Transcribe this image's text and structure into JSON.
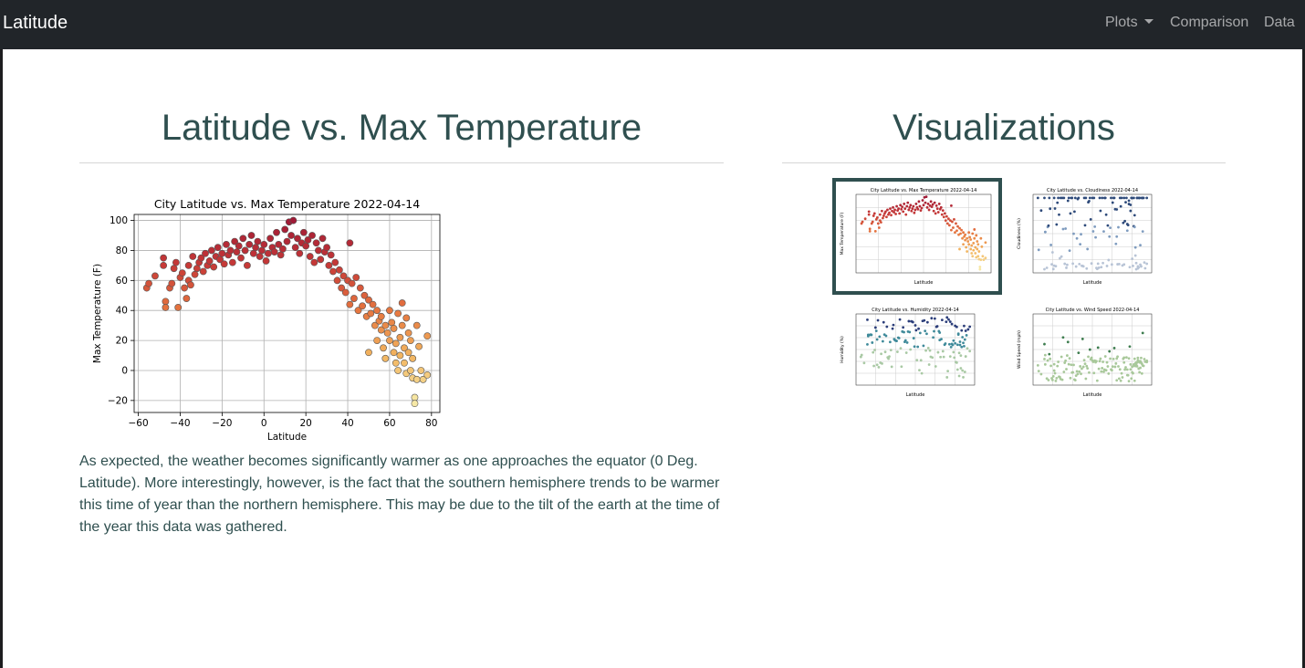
{
  "nav": {
    "brand": "Latitude",
    "items": [
      {
        "label": "Plots",
        "dropdown": true
      },
      {
        "label": "Comparison",
        "dropdown": false
      },
      {
        "label": "Data",
        "dropdown": false
      }
    ]
  },
  "main": {
    "title": "Latitude vs. Max Temperature",
    "description": "As expected, the weather becomes significantly warmer as one approaches the equator (0 Deg. Latitude). More interestingly, however, is the fact that the southern hemisphere trends to be warmer this time of year than the northern hemisphere. This may be due to the tilt of the earth at the time of the year this data was gathered."
  },
  "sidebar": {
    "title": "Visualizations",
    "thumbnails": [
      {
        "title": "City Latitude vs. Max Temperature 2022-04-14",
        "ylabel": "Max Temperature (F)",
        "active": true
      },
      {
        "title": "City Latitude vs. Cloudiness 2022-04-14",
        "ylabel": "Cloudiness (%)",
        "active": false
      },
      {
        "title": "City Latitude vs. Humidity 2022-04-14",
        "ylabel": "Humidity (%)",
        "active": false
      },
      {
        "title": "City Latitude vs. Wind Speed 2022-04-14",
        "ylabel": "Wind Speed (mph)",
        "active": false
      }
    ]
  },
  "colors": {
    "navbar": "#212529",
    "heading": "#2f4f4f",
    "temp_hot": "#a50f2d",
    "temp_cold": "#f5e39a"
  },
  "chart_data": {
    "type": "scatter",
    "title": "City Latitude vs. Max Temperature 2022-04-14",
    "xlabel": "Latitude",
    "ylabel": "Max Temperature (F)",
    "xlim": [
      -62,
      84
    ],
    "ylim": [
      -28,
      104
    ],
    "xticks": [
      -60,
      -40,
      -20,
      0,
      20,
      40,
      60,
      80
    ],
    "yticks": [
      -20,
      0,
      20,
      40,
      60,
      80,
      100
    ],
    "grid": true,
    "points": [
      [
        -56,
        55
      ],
      [
        -55,
        58
      ],
      [
        -52,
        63
      ],
      [
        -48,
        75
      ],
      [
        -48,
        70
      ],
      [
        -47,
        46
      ],
      [
        -47,
        42
      ],
      [
        -45,
        55
      ],
      [
        -44,
        58
      ],
      [
        -43,
        68
      ],
      [
        -42,
        72
      ],
      [
        -41,
        42
      ],
      [
        -40,
        62
      ],
      [
        -39,
        65
      ],
      [
        -38,
        55
      ],
      [
        -37,
        48
      ],
      [
        -36,
        70
      ],
      [
        -36,
        60
      ],
      [
        -35,
        57
      ],
      [
        -34,
        76
      ],
      [
        -33,
        64
      ],
      [
        -32,
        68
      ],
      [
        -31,
        72
      ],
      [
        -30,
        75
      ],
      [
        -29,
        66
      ],
      [
        -28,
        78
      ],
      [
        -27,
        70
      ],
      [
        -26,
        73
      ],
      [
        -25,
        80
      ],
      [
        -24,
        69
      ],
      [
        -23,
        76
      ],
      [
        -22,
        82
      ],
      [
        -21,
        74
      ],
      [
        -20,
        78
      ],
      [
        -19,
        71
      ],
      [
        -18,
        84
      ],
      [
        -17,
        77
      ],
      [
        -16,
        80
      ],
      [
        -15,
        72
      ],
      [
        -14,
        86
      ],
      [
        -13,
        79
      ],
      [
        -12,
        83
      ],
      [
        -11,
        75
      ],
      [
        -10,
        88
      ],
      [
        -9,
        80
      ],
      [
        -8,
        70
      ],
      [
        -7,
        84
      ],
      [
        -6,
        90
      ],
      [
        -5,
        78
      ],
      [
        -4,
        82
      ],
      [
        -3,
        86
      ],
      [
        -2,
        76
      ],
      [
        -1,
        80
      ],
      [
        0,
        84
      ],
      [
        1,
        73
      ],
      [
        2,
        78
      ],
      [
        3,
        88
      ],
      [
        4,
        82
      ],
      [
        5,
        79
      ],
      [
        6,
        92
      ],
      [
        7,
        84
      ],
      [
        8,
        77
      ],
      [
        9,
        81
      ],
      [
        10,
        94
      ],
      [
        11,
        86
      ],
      [
        12,
        99
      ],
      [
        13,
        90
      ],
      [
        14,
        100
      ],
      [
        15,
        82
      ],
      [
        16,
        88
      ],
      [
        17,
        78
      ],
      [
        18,
        85
      ],
      [
        19,
        92
      ],
      [
        20,
        83
      ],
      [
        21,
        87
      ],
      [
        22,
        76
      ],
      [
        23,
        90
      ],
      [
        24,
        72
      ],
      [
        25,
        85
      ],
      [
        26,
        80
      ],
      [
        27,
        74
      ],
      [
        28,
        88
      ],
      [
        29,
        79
      ],
      [
        30,
        82
      ],
      [
        31,
        70
      ],
      [
        32,
        77
      ],
      [
        33,
        66
      ],
      [
        34,
        72
      ],
      [
        35,
        60
      ],
      [
        36,
        67
      ],
      [
        37,
        55
      ],
      [
        38,
        63
      ],
      [
        39,
        52
      ],
      [
        40,
        60
      ],
      [
        41,
        85
      ],
      [
        41,
        44
      ],
      [
        42,
        58
      ],
      [
        43,
        48
      ],
      [
        44,
        62
      ],
      [
        45,
        40
      ],
      [
        46,
        55
      ],
      [
        47,
        43
      ],
      [
        48,
        50
      ],
      [
        49,
        36
      ],
      [
        50,
        47
      ],
      [
        50,
        12
      ],
      [
        51,
        38
      ],
      [
        52,
        44
      ],
      [
        53,
        30
      ],
      [
        54,
        40
      ],
      [
        54,
        20
      ],
      [
        55,
        33
      ],
      [
        56,
        36
      ],
      [
        56,
        27
      ],
      [
        57,
        15
      ],
      [
        58,
        30
      ],
      [
        58,
        8
      ],
      [
        59,
        25
      ],
      [
        60,
        20
      ],
      [
        60,
        40
      ],
      [
        61,
        32
      ],
      [
        62,
        28
      ],
      [
        62,
        12
      ],
      [
        63,
        5
      ],
      [
        63,
        18
      ],
      [
        64,
        38
      ],
      [
        64,
        0
      ],
      [
        65,
        22
      ],
      [
        65,
        10
      ],
      [
        66,
        45
      ],
      [
        66,
        30
      ],
      [
        67,
        15
      ],
      [
        67,
        5
      ],
      [
        68,
        -2
      ],
      [
        68,
        35
      ],
      [
        69,
        25
      ],
      [
        69,
        12
      ],
      [
        70,
        0
      ],
      [
        70,
        20
      ],
      [
        71,
        -5
      ],
      [
        71,
        8
      ],
      [
        72,
        -18
      ],
      [
        72,
        -22
      ],
      [
        73,
        30
      ],
      [
        73,
        -6
      ],
      [
        74,
        16
      ],
      [
        75,
        0
      ],
      [
        76,
        -6
      ],
      [
        78,
        23
      ],
      [
        78,
        -3
      ]
    ]
  }
}
